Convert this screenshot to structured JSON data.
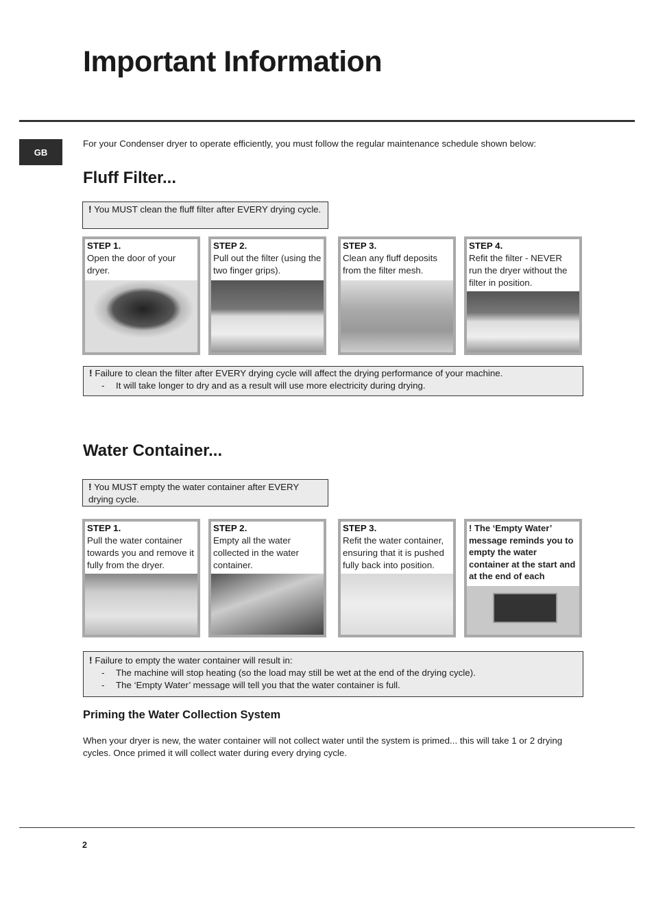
{
  "title": "Important Information",
  "lang_badge": "GB",
  "intro": "For your Condenser dryer to operate efficiently, you must follow the regular maintenance schedule shown below:",
  "fluff": {
    "heading": "Fluff Filter...",
    "must_note": {
      "bang": "!",
      "text": " You MUST clean the fluff filter after EVERY drying cycle."
    },
    "steps": [
      {
        "label": "STEP 1.",
        "text": "Open the door of your dryer."
      },
      {
        "label": "STEP 2.",
        "text": "Pull out the filter (using the two finger grips)."
      },
      {
        "label": "STEP 3.",
        "text": "Clean any fluff deposits from the filter mesh."
      },
      {
        "label": "STEP 4.",
        "text": "Refit the filter - NEVER run the dryer without the filter in position."
      }
    ],
    "warning": {
      "bang": "!",
      "text": " Failure to clean the filter after EVERY drying cycle will affect the drying performance of your machine.",
      "items": [
        "It will take longer to dry and as a result will use more electricity during drying."
      ]
    }
  },
  "water": {
    "heading": "Water Container...",
    "must_note": {
      "bang": "!",
      "text": " You MUST empty the water container after EVERY drying cycle."
    },
    "steps": [
      {
        "label": "STEP 1.",
        "text": "Pull the water container towards you and remove it fully from the dryer."
      },
      {
        "label": "STEP 2.",
        "text": "Empty all the water collected in the water container."
      },
      {
        "label": "STEP 3.",
        "text": "Refit the water container, ensuring that it is pushed fully back into position."
      }
    ],
    "reminder": {
      "bang": "!",
      "text": " The ‘Empty Water’ message reminds you to empty the water container at the start and at the end of each programme."
    },
    "warning": {
      "bang": "!",
      "text": " Failure to empty the water container will result in:",
      "items": [
        "The machine will stop heating (so the load may still be wet at the end of the drying cycle).",
        "The ‘Empty Water’ message will tell you that the water container is full."
      ]
    }
  },
  "priming": {
    "heading": "Priming the Water Collection System",
    "text": "When your dryer is new, the water container will not collect water until the system is primed... this will take 1 or 2 drying cycles. Once primed it will collect water during every drying cycle."
  },
  "page_number": "2",
  "dash": "-"
}
